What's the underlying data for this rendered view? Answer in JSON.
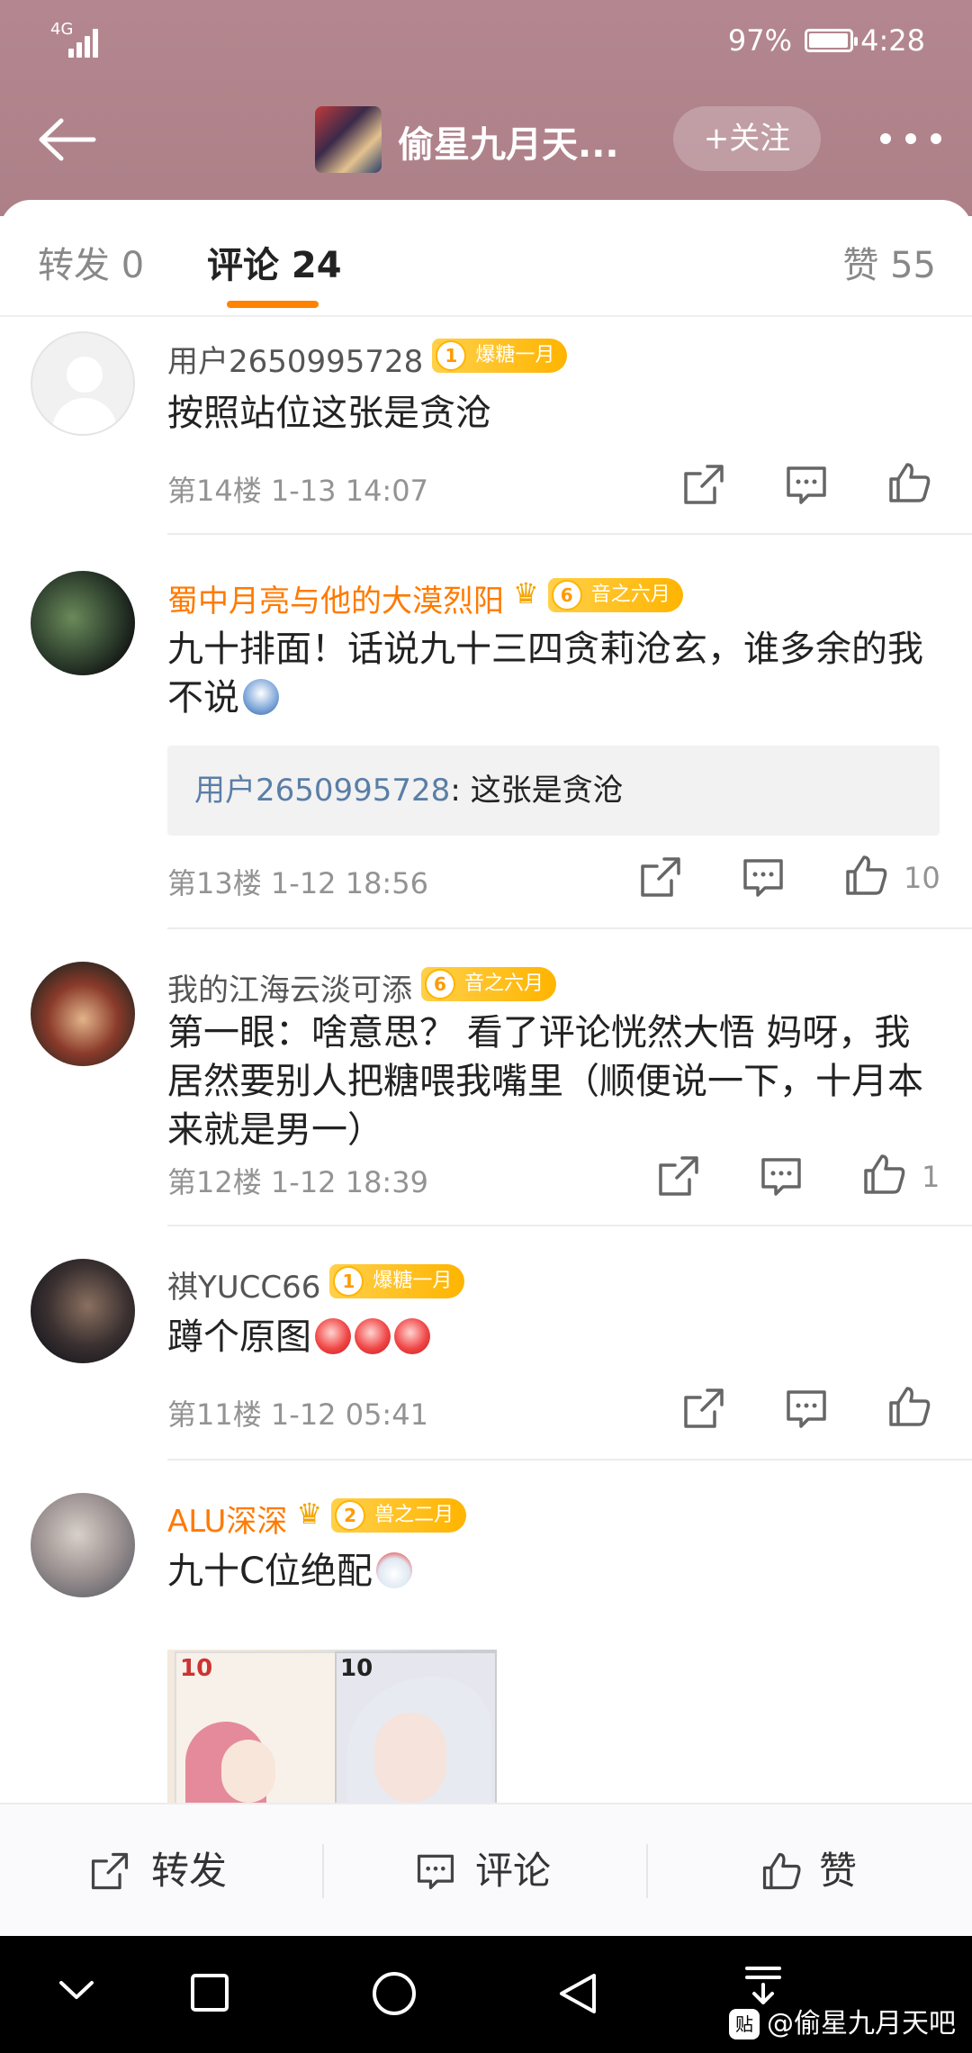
{
  "status_bar": {
    "network": "4G",
    "battery": "97%",
    "time": "4:28"
  },
  "header": {
    "title": "偷星九月天...",
    "follow_label": "+关注"
  },
  "tabs": [
    {
      "label": "转发 0"
    },
    {
      "label": "评论 24"
    },
    {
      "label": "赞 55"
    }
  ],
  "comments": [
    {
      "username": "用户2650995728",
      "badge_level": "1",
      "badge_text": "爆糖一月",
      "text": "按照站位这张是贪沧",
      "floor": "第14楼",
      "time": "1-13 14:07",
      "likes": ""
    },
    {
      "username": "蜀中月亮与他的大漠烈阳",
      "badge_level": "6",
      "badge_text": "音之六月",
      "text": "九十排面！话说九十三四贪莉沧玄，谁多余的我不说",
      "quote_user": "用户2650995728",
      "quote_text": ": 这张是贪沧",
      "floor": "第13楼",
      "time": "1-12 18:56",
      "likes": "10"
    },
    {
      "username": "我的江海云淡可添",
      "badge_level": "6",
      "badge_text": "音之六月",
      "text": "第一眼：啥意思？ 看了评论恍然大悟 妈呀，我居然要别人把糖喂我嘴里（顺便说一下，十月本来就是男一）",
      "floor": "第12楼",
      "time": "1-12 18:39",
      "likes": "1"
    },
    {
      "username": "祺YUCC66",
      "badge_level": "1",
      "badge_text": "爆糖一月",
      "text": "蹲个原图",
      "floor": "第11楼",
      "time": "1-12 05:41",
      "likes": ""
    },
    {
      "username": "ALU深深",
      "badge_level": "2",
      "badge_text": "兽之二月",
      "text": "九十C位绝配",
      "photo_labels": [
        "10",
        "10"
      ]
    }
  ],
  "bottom_bar": {
    "repost": "转发",
    "comment": "评论",
    "like": "赞"
  },
  "watermark": "@偷星九月天吧",
  "colors": {
    "header_bg": "#b48790",
    "accent": "#ff8200",
    "vip_name": "#ff7a00",
    "link": "#5a7ea6",
    "badge": "#ffb400"
  }
}
